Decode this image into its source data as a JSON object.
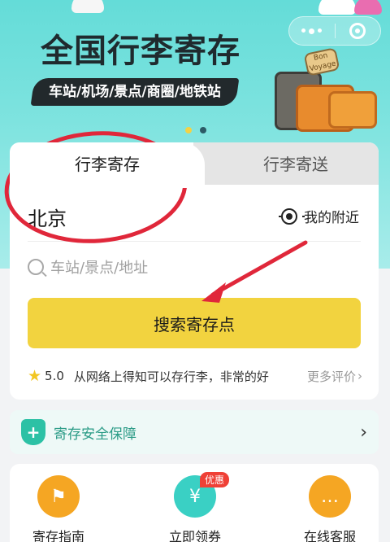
{
  "banner": {
    "title": "全国行李寄存",
    "subtitle": "车站/机场/景点/商圈/地铁站",
    "luggage_tag": "Bon Voyage"
  },
  "mini_program_capsule": {
    "more_icon": "more-dots-icon",
    "close_icon": "close-circle-icon"
  },
  "carousel": {
    "count": 2,
    "active_index": 0,
    "active_color": "#f3d245"
  },
  "tabs": [
    {
      "label": "行李寄存",
      "active": true
    },
    {
      "label": "行李寄送",
      "active": false
    }
  ],
  "location": {
    "city": "北京",
    "nearby_label": "我的附近",
    "nearby_icon": "locate-icon"
  },
  "search": {
    "placeholder": "车站/景点/地址",
    "button_label": "搜索寄存点",
    "button_color": "#f2d33f"
  },
  "review": {
    "score": "5.0",
    "text": "从网络上得知可以存行李，非常的好",
    "more_label": "更多评价"
  },
  "security": {
    "label": "寄存安全保障",
    "icon": "shield-plus-icon",
    "accent": "#2cc1a5"
  },
  "services": [
    {
      "label": "寄存指南",
      "icon": "signpost-icon",
      "color": "#f5a623"
    },
    {
      "label": "立即领券",
      "icon": "coupon-icon",
      "color": "#3ad0c4",
      "badge": "优惠"
    },
    {
      "label": "在线客服",
      "icon": "chat-icon",
      "color": "#f5a623"
    }
  ],
  "annotation_color": "#e0273a"
}
